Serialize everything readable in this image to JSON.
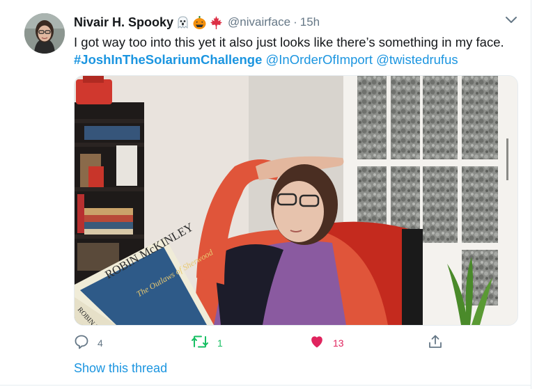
{
  "tweet": {
    "display_name": "Nivair H. Spooky",
    "name_emojis": [
      "ghost-emoji",
      "jack-o-lantern-emoji",
      "maple-leaf-emoji"
    ],
    "handle": "@nivairface",
    "separator": "·",
    "time": "15h",
    "text_line1": "I got way too into this yet it also just looks like there’s something in my face.",
    "hashtag": "#JoshInTheSolariumChallenge",
    "mention1": "@InOrderOfImport",
    "mention2": "@twistedrufus",
    "media_book_author": "ROBIN McKINLEY",
    "media_book_title": "The Outlaws of Sherwood",
    "media_book_spine": "ROBIN McK"
  },
  "actions": {
    "reply_count": "4",
    "retweet_count": "1",
    "like_count": "13"
  },
  "show_thread_label": "Show this thread",
  "colors": {
    "link": "#1b95e0",
    "retweet_active": "#17bf63",
    "like_active": "#e0245e",
    "secondary_text": "#657786"
  },
  "icons": [
    "chevron-down-icon",
    "reply-icon",
    "retweet-icon",
    "heart-icon",
    "share-icon"
  ]
}
